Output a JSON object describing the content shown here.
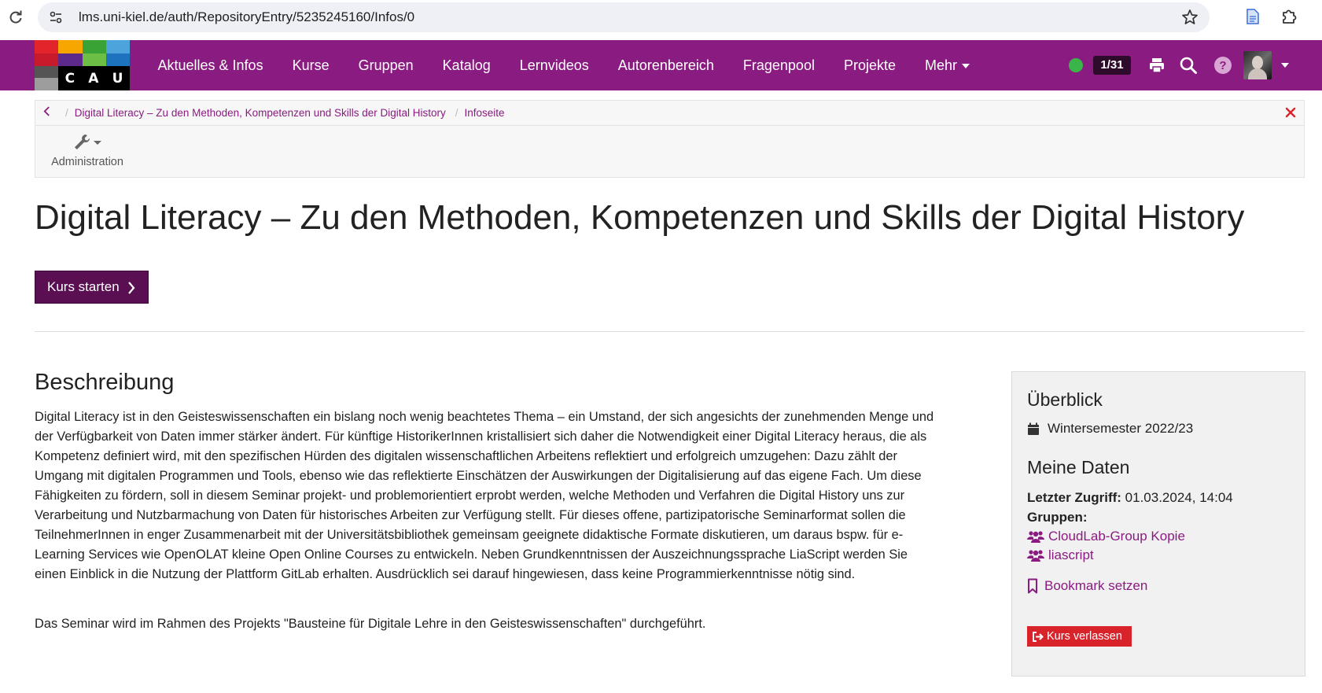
{
  "browser": {
    "url": "lms.uni-kiel.de/auth/RepositoryEntry/5235245160/Infos/0"
  },
  "logo": {
    "letters": [
      "C",
      "A",
      "U"
    ],
    "colors": [
      "#e2252a",
      "#f7a600",
      "#3aa335",
      "#4da3dc",
      "#1b1b1b",
      "#5d2a8c",
      "#6cbe45",
      "#1e73be"
    ]
  },
  "nav": {
    "items": [
      {
        "label": "Aktuelles & Infos"
      },
      {
        "label": "Kurse"
      },
      {
        "label": "Gruppen"
      },
      {
        "label": "Katalog"
      },
      {
        "label": "Lernvideos"
      },
      {
        "label": "Autorenbereich"
      },
      {
        "label": "Fragenpool"
      },
      {
        "label": "Projekte"
      }
    ],
    "more_label": "Mehr",
    "counter": "1/31",
    "status_color": "#3ab54a",
    "brand_color": "#8a1b81"
  },
  "breadcrumb": {
    "items": [
      {
        "label": "Digital Literacy – Zu den Methoden, Kompetenzen und Skills der Digital History"
      },
      {
        "label": "Infoseite"
      }
    ]
  },
  "toolbar": {
    "admin_label": "Administration"
  },
  "course": {
    "title": "Digital Literacy – Zu den Methoden, Kompetenzen und Skills der Digital History",
    "start_label": "Kurs starten"
  },
  "description": {
    "title": "Beschreibung",
    "text": "Digital Literacy ist in den Geisteswissenschaften ein bislang noch wenig beachtetes Thema – ein Umstand, der sich angesichts der zunehmenden Menge und der Verfügbarkeit von Daten immer stärker ändert. Für künftige HistorikerInnen kristallisiert sich daher die Notwendigkeit einer Digital Literacy heraus, die als Kompetenz definiert wird, mit den spezifischen Hürden des digitalen wissenschaftlichen Arbeitens reflektiert und erfolgreich umzugehen: Dazu zählt der Umgang mit digitalen Programmen und Tools, ebenso wie das reflektierte Einschätzen der Auswirkungen der Digitalisierung auf das eigene Fach. Um diese Fähigkeiten zu fördern, soll in diesem Seminar projekt- und problemorientiert erprobt werden, welche Methoden und Verfahren die Digital History uns zur Verarbeitung und Nutzbarmachung von Daten für historisches Arbeiten zur Verfügung stellt. Für dieses offene, partizipatorische Seminarformat sollen die TeilnehmerInnen in enger Zusammenarbeit mit der Universitätsbibliothek gemeinsam geeignete didaktische Formate diskutieren, um daraus bspw. für e-Learning Services wie OpenOLAT kleine Open Online Courses zu entwickeln. Neben Grundkenntnissen der Auszeichnungssprache LiaScript werden Sie einen Einblick in die Nutzung der Plattform GitLab erhalten. Ausdrücklich sei darauf hingewiesen, dass keine Programmierkenntnisse nötig sind.",
    "note": "Das Seminar wird im Rahmen des Projekts \"Bausteine für Digitale Lehre in den Geisteswissenschaften\" durchgeführt."
  },
  "sidebar": {
    "overview_title": "Überblick",
    "semester": "Wintersemester 2022/23",
    "mydata_title": "Meine Daten",
    "last_access_label": "Letzter Zugriff:",
    "last_access_value": "01.03.2024, 14:04",
    "groups_label": "Gruppen:",
    "groups": [
      {
        "label": "CloudLab-Group Kopie"
      },
      {
        "label": "liascript"
      }
    ],
    "bookmark_label": "Bookmark setzen",
    "leave_label": "Kurs verlassen",
    "leave_color": "#d9232b"
  }
}
